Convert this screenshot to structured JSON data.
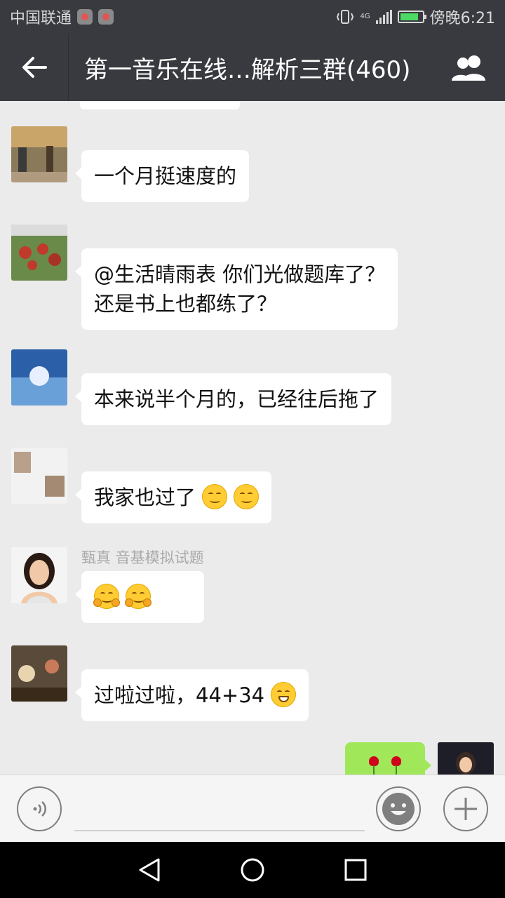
{
  "status_bar": {
    "carrier": "中国联通",
    "network": "4G",
    "time": "傍晚6:21",
    "battery_level": 0.85,
    "accent": "#4cd964"
  },
  "header": {
    "title": "第一音乐在线…解析三群(460)",
    "back_icon": "arrow-left-icon",
    "members_icon": "group-members-icon"
  },
  "messages": [
    {
      "sender": "",
      "text": "一个月挺速度的",
      "emoji": []
    },
    {
      "sender": "",
      "text": "@生活晴雨表 你们光做题库了？",
      "text2": "还是书上也都练了？",
      "emoji": []
    },
    {
      "sender": "",
      "text": "本来说半个月的，已经往后拖了",
      "emoji": []
    },
    {
      "sender": "",
      "text": "我家也过了",
      "emoji": [
        "smile-emoji",
        "smile-emoji"
      ]
    },
    {
      "sender": "甄真 音基模拟试题",
      "text": "",
      "emoji": [
        "hug-emoji",
        "hug-emoji"
      ]
    },
    {
      "sender": "",
      "text": "过啦过啦，44+34",
      "emoji": [
        "grin-emoji"
      ]
    }
  ],
  "my_message": {
    "emoji": [
      "rose-icon",
      "rose-icon"
    ],
    "bubble_color": "#a0e75a"
  },
  "input_bar": {
    "placeholder": "",
    "voice_icon": "voice-icon",
    "emoji_icon": "emoji-icon",
    "plus_icon": "plus-icon"
  },
  "nav_bar": {
    "back_icon": "nav-back-icon",
    "home_icon": "nav-home-icon",
    "recent_icon": "nav-recent-icon"
  }
}
